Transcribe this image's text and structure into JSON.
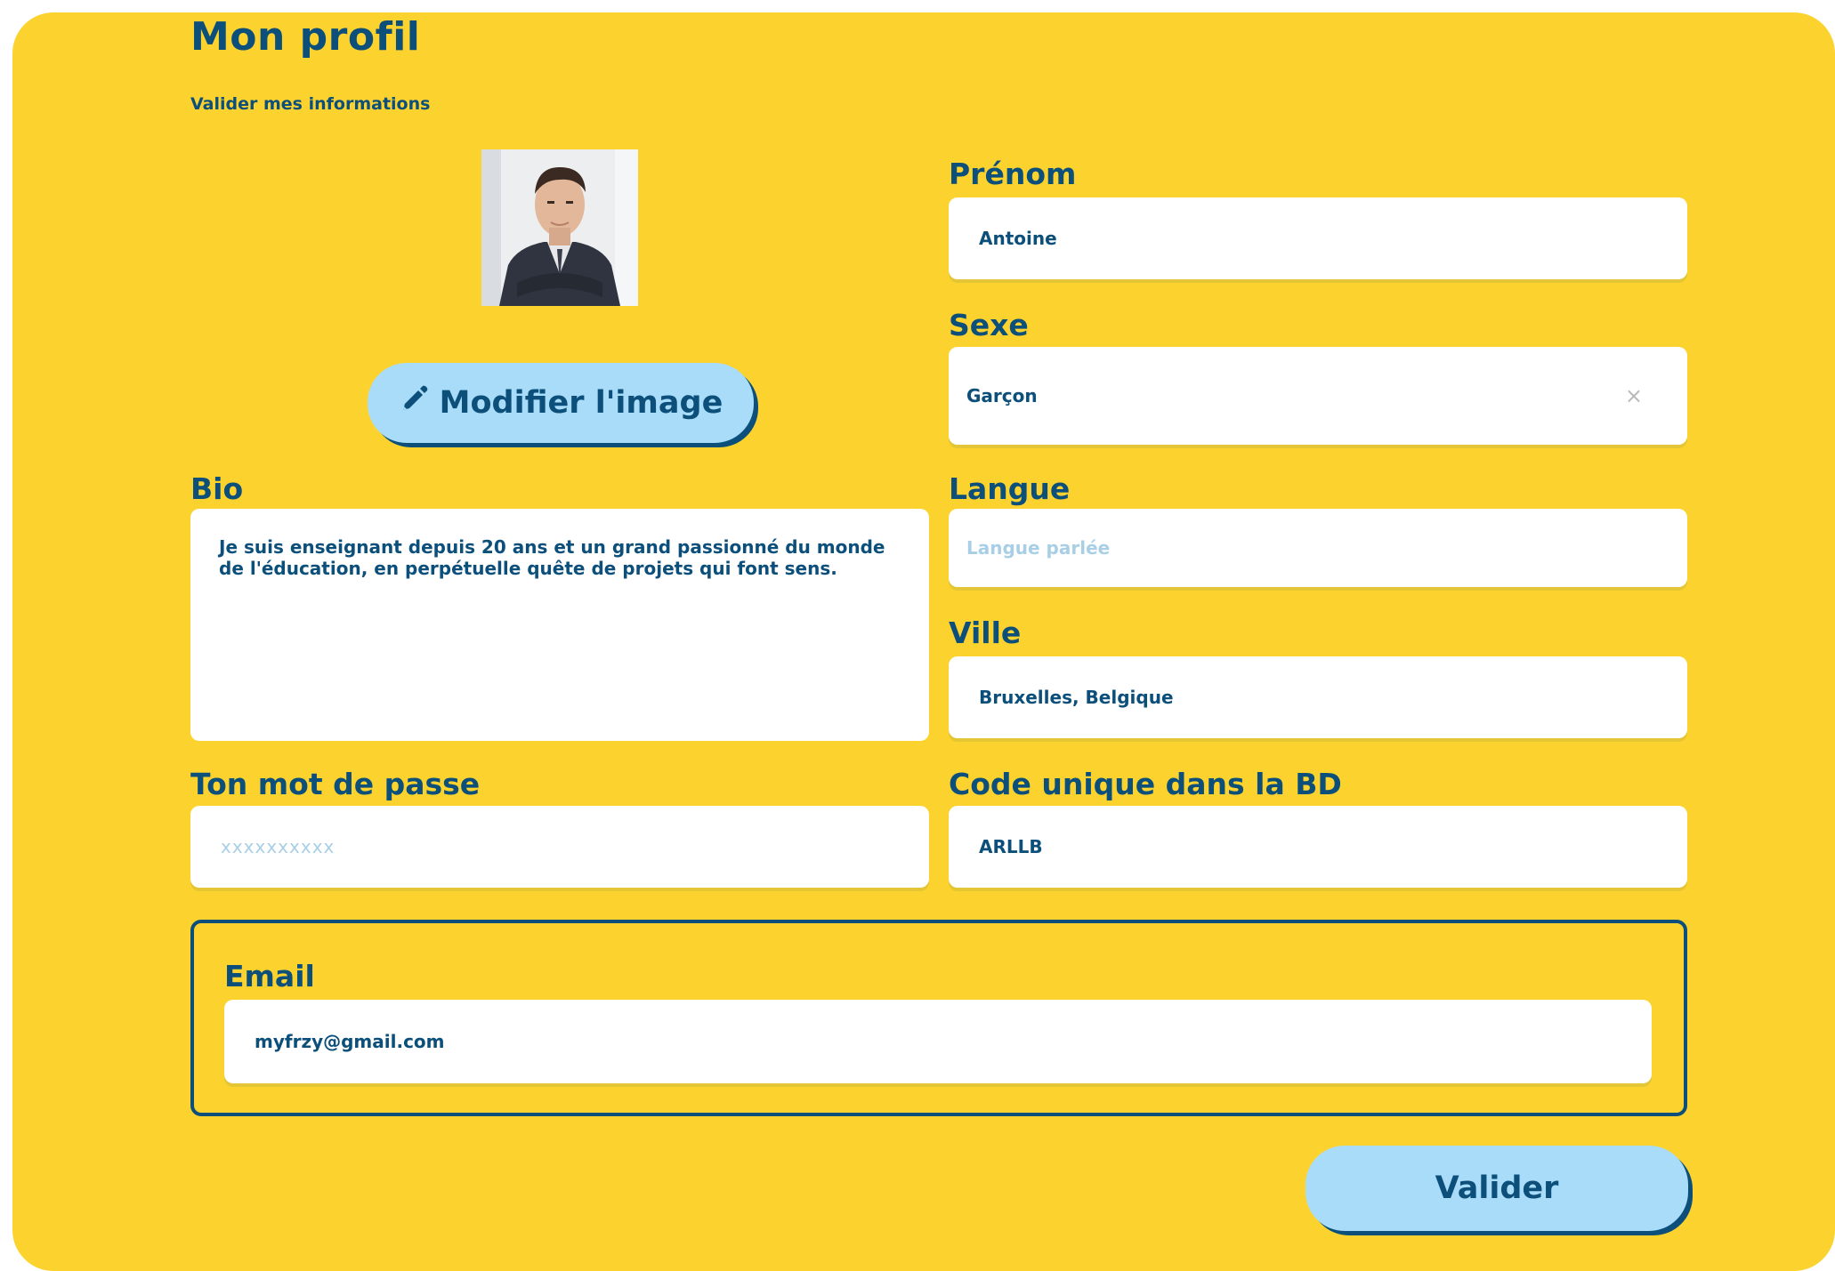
{
  "page": {
    "title": "Mon profil",
    "subtitle": "Valider mes informations"
  },
  "avatar": {
    "alt": "Photo de profil"
  },
  "modify_image": {
    "icon": "pencil-icon",
    "label": "Modifier l'image"
  },
  "fields": {
    "prenom": {
      "label": "Prénom",
      "value": "Antoine"
    },
    "sexe": {
      "label": "Sexe",
      "value": "Garçon",
      "clear": "×"
    },
    "bio": {
      "label": "Bio",
      "value": "Je suis enseignant depuis 20 ans et un grand passionné du monde de l'éducation, en perpétuelle quête de projets qui font sens."
    },
    "langue": {
      "label": "Langue",
      "placeholder": "Langue parlée"
    },
    "ville": {
      "label": "Ville",
      "value": "Bruxelles, Belgique"
    },
    "password": {
      "label": "Ton mot de passe",
      "placeholder": "xxxxxxxxxx"
    },
    "code": {
      "label": "Code unique dans la BD",
      "value": "ARLLB"
    },
    "email": {
      "label": "Email",
      "value": "myfrzy@gmail.com"
    }
  },
  "submit": {
    "label": "Valider"
  },
  "colors": {
    "background": "#fcd32e",
    "primary": "#0b4f7a",
    "button": "#a8dcf8",
    "placeholder": "#a9cfe6"
  }
}
